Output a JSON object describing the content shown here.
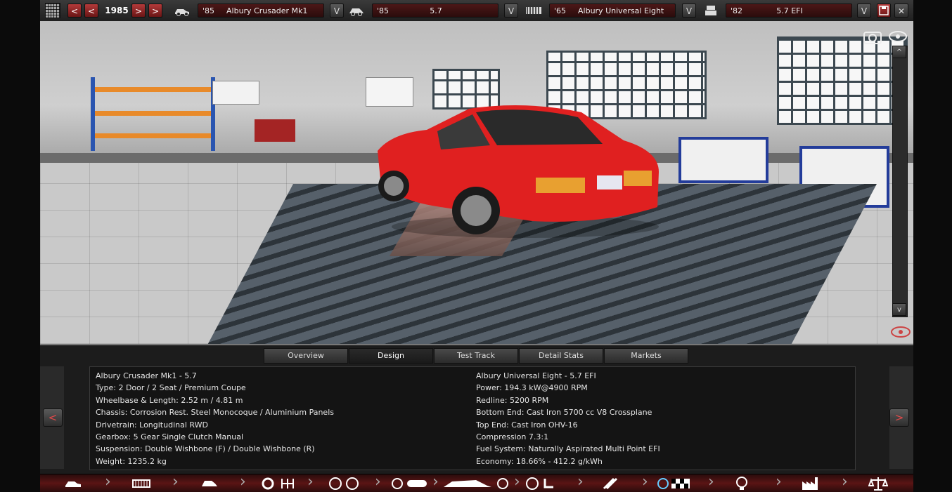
{
  "topbar": {
    "year": "1985",
    "car_model": {
      "year": "'85",
      "name": "Albury Crusader Mk1"
    },
    "car_trim": {
      "year": "'85",
      "name": "5.7"
    },
    "engine_family": {
      "year": "'65",
      "name": "Albury Universal Eight"
    },
    "engine_variant": {
      "year": "'82",
      "name": "5.7 EFI"
    },
    "prev_fast": "<",
    "prev": "<",
    "next": ">",
    "next_fast": ">",
    "dropdown": "V",
    "close": "✕"
  },
  "scroll": {
    "up": "^",
    "down": "v"
  },
  "tabs": [
    "Overview",
    "Design",
    "Test Track",
    "Detail Stats",
    "Markets"
  ],
  "active_tab": "Design",
  "car_stats": [
    "Albury Crusader Mk1 - 5.7",
    "Type: 2 Door / 2 Seat / Premium Coupe",
    "Wheelbase & Length: 2.52 m / 4.81 m",
    "Chassis: Corrosion Rest. Steel Monocoque / Aluminium Panels",
    "Drivetrain: Longitudinal RWD",
    "Gearbox: 5 Gear Single Clutch Manual",
    "Suspension: Double Wishbone (F) / Double Wishbone (R)",
    "Weight: 1235.2 kg"
  ],
  "engine_stats": [
    "Albury Universal Eight - 5.7 EFI",
    "Power: 194.3 kW@4900 RPM",
    "Redline: 5200 RPM",
    "Bottom End: Cast Iron 5700 cc V8 Crossplane",
    "Top End: Cast Iron OHV-16",
    "Compression 7.3:1",
    "Fuel System: Naturally Aspirated Multi Point EFI",
    "Economy: 18.66% - 412.2 g/kWh"
  ],
  "panel_arrows": {
    "left": "<",
    "right": ">"
  },
  "colors": {
    "accent_red": "#8a1a1a",
    "car_red": "#e02020",
    "panel_bg": "#1c1c1c"
  }
}
